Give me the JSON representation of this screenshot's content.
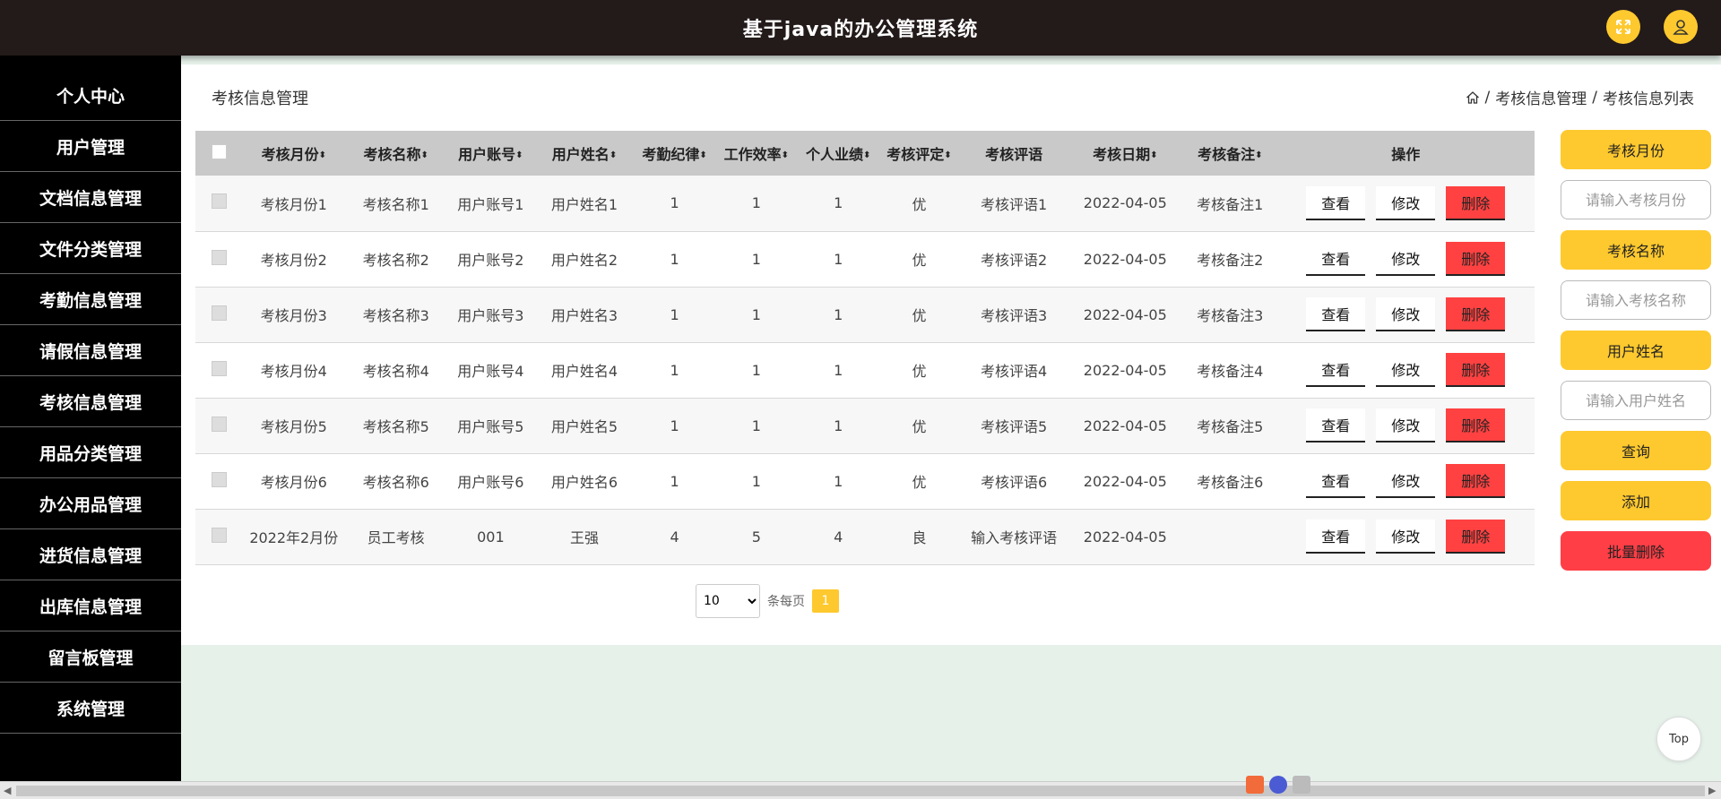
{
  "header": {
    "title": "基于java的办公管理系统",
    "fullscreen_icon": "expand-icon",
    "user_icon": "user-icon",
    "accent_color": "#fec92e"
  },
  "sidebar": {
    "items": [
      {
        "label": "个人中心"
      },
      {
        "label": "用户管理"
      },
      {
        "label": "文档信息管理"
      },
      {
        "label": "文件分类管理"
      },
      {
        "label": "考勤信息管理"
      },
      {
        "label": "请假信息管理"
      },
      {
        "label": "考核信息管理"
      },
      {
        "label": "用品分类管理"
      },
      {
        "label": "办公用品管理"
      },
      {
        "label": "进货信息管理"
      },
      {
        "label": "出库信息管理"
      },
      {
        "label": "留言板管理"
      },
      {
        "label": "系统管理"
      }
    ]
  },
  "page": {
    "title": "考核信息管理",
    "breadcrumb": [
      "考核信息管理",
      "考核信息列表"
    ],
    "breadcrumb_sep": "/"
  },
  "table": {
    "columns": [
      "考核月份",
      "考核名称",
      "用户账号",
      "用户姓名",
      "考勤纪律",
      "工作效率",
      "个人业绩",
      "考核评定",
      "考核评语",
      "考核日期",
      "考核备注",
      "操作"
    ],
    "sortable": [
      true,
      true,
      true,
      true,
      true,
      true,
      true,
      true,
      false,
      true,
      true,
      false
    ],
    "rows": [
      [
        "考核月份1",
        "考核名称1",
        "用户账号1",
        "用户姓名1",
        "1",
        "1",
        "1",
        "优",
        "考核评语1",
        "2022-04-05",
        "考核备注1"
      ],
      [
        "考核月份2",
        "考核名称2",
        "用户账号2",
        "用户姓名2",
        "1",
        "1",
        "1",
        "优",
        "考核评语2",
        "2022-04-05",
        "考核备注2"
      ],
      [
        "考核月份3",
        "考核名称3",
        "用户账号3",
        "用户姓名3",
        "1",
        "1",
        "1",
        "优",
        "考核评语3",
        "2022-04-05",
        "考核备注3"
      ],
      [
        "考核月份4",
        "考核名称4",
        "用户账号4",
        "用户姓名4",
        "1",
        "1",
        "1",
        "优",
        "考核评语4",
        "2022-04-05",
        "考核备注4"
      ],
      [
        "考核月份5",
        "考核名称5",
        "用户账号5",
        "用户姓名5",
        "1",
        "1",
        "1",
        "优",
        "考核评语5",
        "2022-04-05",
        "考核备注5"
      ],
      [
        "考核月份6",
        "考核名称6",
        "用户账号6",
        "用户姓名6",
        "1",
        "1",
        "1",
        "优",
        "考核评语6",
        "2022-04-05",
        "考核备注6"
      ],
      [
        "2022年2月份",
        "员工考核",
        "001",
        "王强",
        "4",
        "5",
        "4",
        "良",
        "输入考核评语",
        "2022-04-05",
        ""
      ]
    ],
    "actions": {
      "view": "查看",
      "edit": "修改",
      "delete": "删除"
    }
  },
  "pagination": {
    "page_size": "10",
    "page_size_options": [
      "10"
    ],
    "per_page_label": "条每页",
    "current_page": "1"
  },
  "search_panel": {
    "month_label": "考核月份",
    "month_placeholder": "请输入考核月份",
    "name_label": "考核名称",
    "name_placeholder": "请输入考核名称",
    "user_label": "用户姓名",
    "user_placeholder": "请输入用户姓名",
    "query_label": "查询",
    "add_label": "添加",
    "batch_delete_label": "批量删除"
  },
  "top_button": "Top"
}
